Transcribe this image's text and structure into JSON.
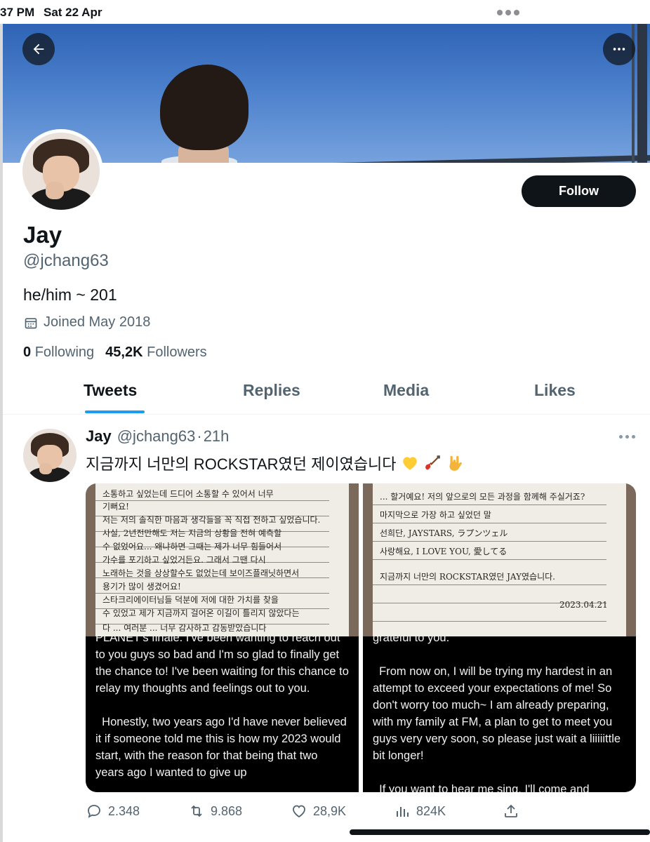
{
  "status_bar": {
    "time": "37 PM",
    "date": "Sat 22 Apr"
  },
  "profile": {
    "name": "Jay",
    "handle": "@jchang63",
    "bio": "he/him ~ 201",
    "joined": "Joined May 2018",
    "following_count": "0",
    "following_label": "Following",
    "followers_count": "45,2K",
    "followers_label": "Followers",
    "follow_label": "Follow"
  },
  "tabs": [
    {
      "label": "Tweets",
      "active": true
    },
    {
      "label": "Replies",
      "active": false
    },
    {
      "label": "Media",
      "active": false
    },
    {
      "label": "Likes",
      "active": false
    }
  ],
  "tweet": {
    "name": "Jay",
    "handle": "@jchang63",
    "separator": "·",
    "time": "21h",
    "text": "지금까지 너만의 ROCKSTAR였던 제이였습니다",
    "emojis": [
      "yellow-heart",
      "guitar",
      "love-you-gesture"
    ],
    "media": [
      {
        "handwriting": [
          "소통하고 싶었는데 드디어 소통할 수 있어서 너무",
          "기뻐요!",
          "저는 저의 솔직한 마음과 생각들을 꼭 직접 전하고 싶었습니다.",
          "사실, 2년전만해도 저는 지금의 상황을 전혀 예측할",
          "수 없었어요... 왜냐하면 그때는 제가 너무 힘들어서",
          "가수를 포기하고 싶었거든요. 그래서 그땐 다시",
          "노래하는 것을 상상할수도 없었는데 보이즈플래닛하면서",
          "용기가 많이 생겼어요!",
          "스타크리에이터님들 덕분에 저에 대한 가치를 찾을",
          "수 있었고 제가 지금까지 걸어온 이길이 틀리지 않았다는",
          "다 ... 여러분 ... 너무 감사하고 감동받았습니다"
        ],
        "translation": "PLANET's finale. I've been wanting to reach out to you guys so bad and I'm so glad to finally get the chance to! I've been waiting for this chance to relay my thoughts and feelings out to you.\n\n  Honestly, two years ago I'd have never believed it if someone told me this is how my 2023 would start, with the reason for that being that two years ago I wanted to give up"
      },
      {
        "handwriting": [
          "... 할거예요! 저의 앞으로의 모든 과정을 함께해 주실거죠?",
          "마지막으로 가장 하고 싶었던 말",
          "선희단, JAYSTARS, ラプンツェル",
          "사랑해요, I LOVE YOU, 愛してる",
          "지금까지 너만의 ROCKSTAR였던 JAY였습니다.",
          "2023.04.21"
        ],
        "translation": "grateful to you.\n\n  From now on, I will be trying my hardest in an attempt to exceed your expectations of me! So don't worry too much~ I am already preparing, with my family at FM, a plan to get to meet you guys very very soon, so please just wait a liiiiittle bit longer!\n\n  If you want to hear me sing, I'll come and"
      }
    ],
    "replies": "2.348",
    "retweets": "9.868",
    "likes": "28,9K",
    "views": "824K"
  },
  "colors": {
    "accent": "#1d9bf0",
    "text": "#0f1419",
    "secondary": "#536471"
  }
}
